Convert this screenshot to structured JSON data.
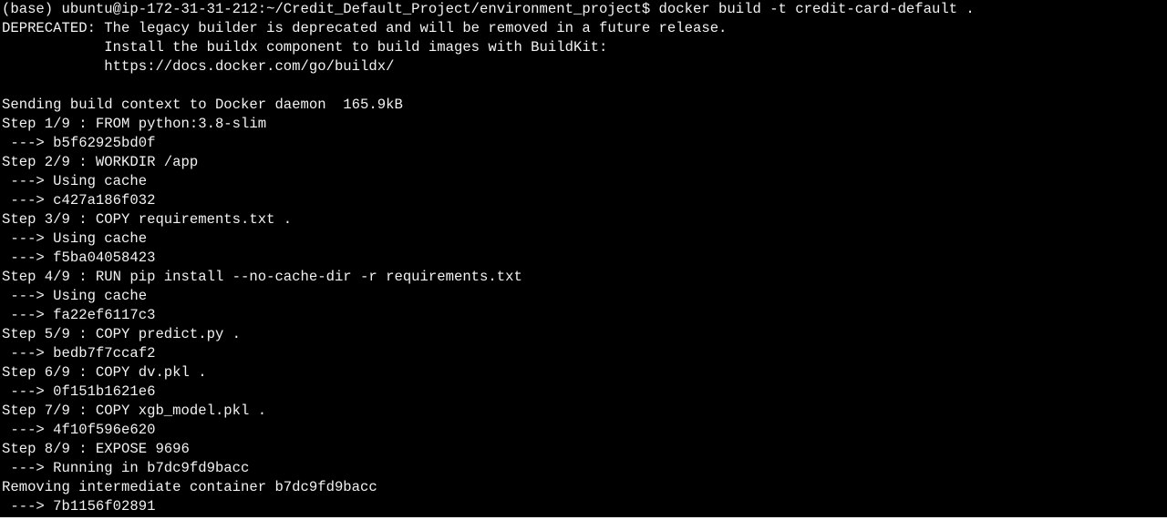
{
  "terminal": {
    "lines": [
      "(base) ubuntu@ip-172-31-31-212:~/Credit_Default_Project/environment_project$ docker build -t credit-card-default .",
      "DEPRECATED: The legacy builder is deprecated and will be removed in a future release.",
      "            Install the buildx component to build images with BuildKit:",
      "            https://docs.docker.com/go/buildx/",
      "",
      "Sending build context to Docker daemon  165.9kB",
      "Step 1/9 : FROM python:3.8-slim",
      " ---> b5f62925bd0f",
      "Step 2/9 : WORKDIR /app",
      " ---> Using cache",
      " ---> c427a186f032",
      "Step 3/9 : COPY requirements.txt .",
      " ---> Using cache",
      " ---> f5ba04058423",
      "Step 4/9 : RUN pip install --no-cache-dir -r requirements.txt",
      " ---> Using cache",
      " ---> fa22ef6117c3",
      "Step 5/9 : COPY predict.py .",
      " ---> bedb7f7ccaf2",
      "Step 6/9 : COPY dv.pkl .",
      " ---> 0f151b1621e6",
      "Step 7/9 : COPY xgb_model.pkl .",
      " ---> 4f10f596e620",
      "Step 8/9 : EXPOSE 9696",
      " ---> Running in b7dc9fd9bacc",
      "Removing intermediate container b7dc9fd9bacc",
      " ---> 7b1156f02891"
    ]
  }
}
